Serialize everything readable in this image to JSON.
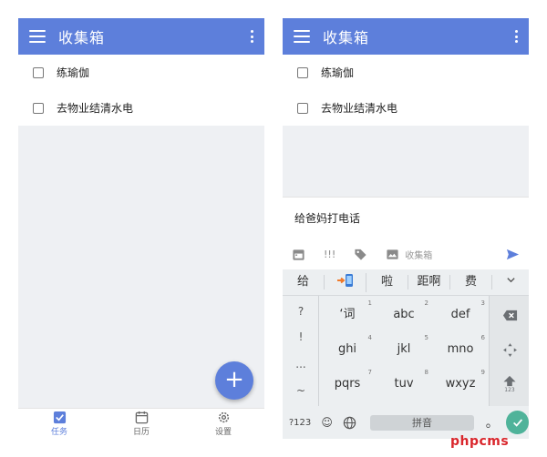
{
  "app": {
    "title": "收集箱",
    "tasks": [
      "练瑜伽",
      "去物业结清水电"
    ]
  },
  "left_screen": {
    "fab_label": "+",
    "bottom_nav": [
      {
        "label": "任务",
        "icon": "checkbox-icon",
        "active": true
      },
      {
        "label": "日历",
        "icon": "calendar-icon",
        "active": false
      },
      {
        "label": "设置",
        "icon": "gear-icon",
        "active": false
      }
    ]
  },
  "right_screen": {
    "input_value": "给爸妈打电话",
    "toolbar": {
      "priority_label": "!!!",
      "list_label": "收集箱"
    },
    "keyboard": {
      "candidates": [
        "给",
        "啦",
        "距啊",
        "费"
      ],
      "left_column": [
        "?",
        "!",
        "...",
        "~"
      ],
      "keys": [
        {
          "label": "‘词",
          "num": "1"
        },
        {
          "label": "abc",
          "num": "2"
        },
        {
          "label": "def",
          "num": "3"
        },
        {
          "label": "ghi",
          "num": "4"
        },
        {
          "label": "jkl",
          "num": "5"
        },
        {
          "label": "mno",
          "num": "6"
        },
        {
          "label": "pqrs",
          "num": "7"
        },
        {
          "label": "tuv",
          "num": "8"
        },
        {
          "label": "wxyz",
          "num": "9"
        }
      ],
      "num_key_sub": "123",
      "bottom": {
        "numbers_label": "?123",
        "smiley": "☺",
        "space_label": "拼音",
        "period": "。"
      }
    }
  },
  "watermark": "phpcms",
  "colors": {
    "accent": "#5d7fdb",
    "enter": "#4fb39a",
    "watermark": "#d9262c"
  }
}
